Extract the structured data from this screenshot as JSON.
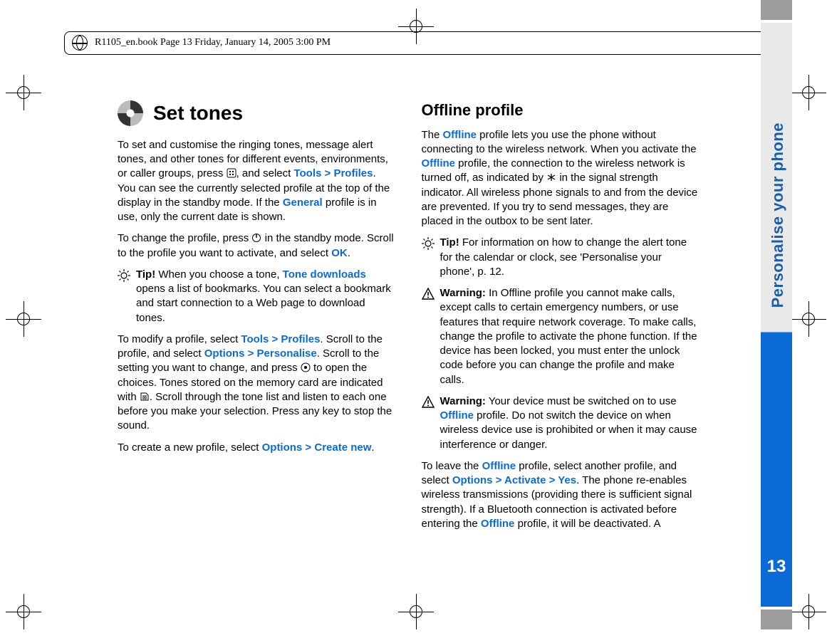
{
  "print_header": "R1105_en.book  Page 13  Friday, January 14, 2005  3:00 PM",
  "side_label": "Personalise your phone",
  "page_number": "13",
  "left": {
    "heading": "Set tones",
    "p1_a": "To set and customise the ringing tones, message alert tones, and other tones for different events, environments, or caller groups, press ",
    "p1_b": ", and select ",
    "p1_link": "Tools > Profiles",
    "p1_c": ". You can see the currently selected profile at the top of the display in the standby mode. If the ",
    "p1_link2": "General",
    "p1_d": " profile is in use, only the current date is shown.",
    "p2_a": "To change the profile, press ",
    "p2_b": " in the standby mode. Scroll to the profile you want to activate, and select ",
    "p2_link": "OK",
    "p2_c": ".",
    "tip1_label": "Tip!",
    "tip1_a": " When you choose a tone, ",
    "tip1_link": "Tone downloads",
    "tip1_b": " opens a list of bookmarks. You can select a bookmark and start connection to a Web page to download tones.",
    "p3_a": "To modify a profile, select ",
    "p3_link1": "Tools > Profiles",
    "p3_b": ". Scroll to the profile, and select ",
    "p3_link2": "Options > Personalise",
    "p3_c": ". Scroll to the setting you want to change, and press ",
    "p3_d": " to open the choices. Tones stored on the memory card are indicated with ",
    "p3_e": ". Scroll through the tone list and listen to each one before you make your selection. Press any key to stop the sound.",
    "p4_a": "To create a new profile, select ",
    "p4_link": "Options > Create new",
    "p4_b": "."
  },
  "right": {
    "heading": "Offline profile",
    "p1_a": "The ",
    "p1_link1": "Offline",
    "p1_b": " profile lets you use the phone without connecting to the wireless network. When you activate the ",
    "p1_link2": "Offline",
    "p1_c": " profile, the connection to the wireless network is turned off, as indicated by ",
    "p1_d": " in the signal strength indicator. All wireless phone signals to and from the device are prevented. If you try to send messages, they are placed in the outbox to be sent later.",
    "tip_label": "Tip!",
    "tip_text": " For information on how to change the alert tone for the calendar or clock, see 'Personalise your phone', p. 12.",
    "warn1_label": "Warning:",
    "warn1_text": " In Offline profile you cannot make calls, except calls to certain emergency numbers, or use features that require network coverage. To make calls, change the profile to activate the phone function. If the device has been locked, you must enter the unlock code before you can change the profile and make calls.",
    "warn2_label": "Warning:",
    "warn2_a": " Your device must be switched on to use ",
    "warn2_link": "Offline",
    "warn2_b": " profile. Do not switch the device on when wireless device use is prohibited or when it may cause interference or danger.",
    "p2_a": "To leave the ",
    "p2_link1": "Offline",
    "p2_b": " profile, select another profile, and select ",
    "p2_link2": "Options > Activate > Yes",
    "p2_c": ". The phone re-enables wireless transmissions (providing there is sufficient signal strength). If a Bluetooth connection is activated before entering the ",
    "p2_link3": "Offline",
    "p2_d": " profile, it will be deactivated. A"
  }
}
